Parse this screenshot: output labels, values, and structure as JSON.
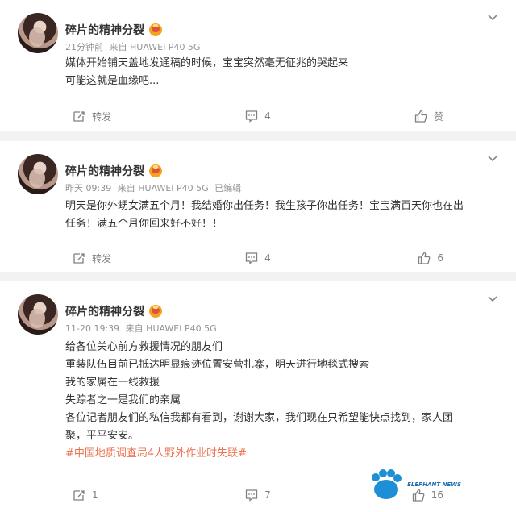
{
  "posts": [
    {
      "author": "碎片的精神分裂",
      "time": "21分钟前",
      "source": "来自 HUAWEI P40 5G",
      "edited": "",
      "lines": [
        "媒体开始铺天盖地发通稿的时候，宝宝突然毫无征兆的哭起来",
        "可能这就是血缘吧..."
      ],
      "hashtag": "",
      "repost_label": "转发",
      "comment_count": "4",
      "like_label": "赞"
    },
    {
      "author": "碎片的精神分裂",
      "time": "昨天 09:39",
      "source": "来自 HUAWEI P40 5G",
      "edited": "已编辑",
      "lines": [
        "明天是你外甥女满五个月！我结婚你出任务！我生孩子你出任务！宝宝满百天你也在出",
        "任务！满五个月你回来好不好！！"
      ],
      "hashtag": "",
      "repost_label": "转发",
      "comment_count": "4",
      "like_label": "6"
    },
    {
      "author": "碎片的精神分裂",
      "time": "11-20 19:39",
      "source": "来自 HUAWEI P40 5G",
      "edited": "",
      "lines": [
        "给各位关心前方救援情况的朋友们",
        "重装队伍目前已抵达明显痕迹位置安营扎寨，明天进行地毯式搜索",
        "我的家属在一线救援",
        "失踪者之一是我们的亲属",
        "各位记者朋友们的私信我都有看到，谢谢大家，我们现在只希望能快点找到，家人团",
        "聚，平平安安。"
      ],
      "hashtag": "#中国地质调查局4人野外作业时失联#",
      "repost_label": "1",
      "comment_count": "7",
      "like_label": "16"
    }
  ],
  "watermark": "ELEPHANT NEWS",
  "icons": [
    "chevron-down-icon",
    "repost-icon",
    "comment-icon",
    "like-icon",
    "verified-badge-icon"
  ],
  "colors": {
    "hashtag": "#eb7350",
    "meta": "#939393",
    "action": "#808080",
    "badge": "#f4a321",
    "watermark": "#1e6fb3"
  }
}
